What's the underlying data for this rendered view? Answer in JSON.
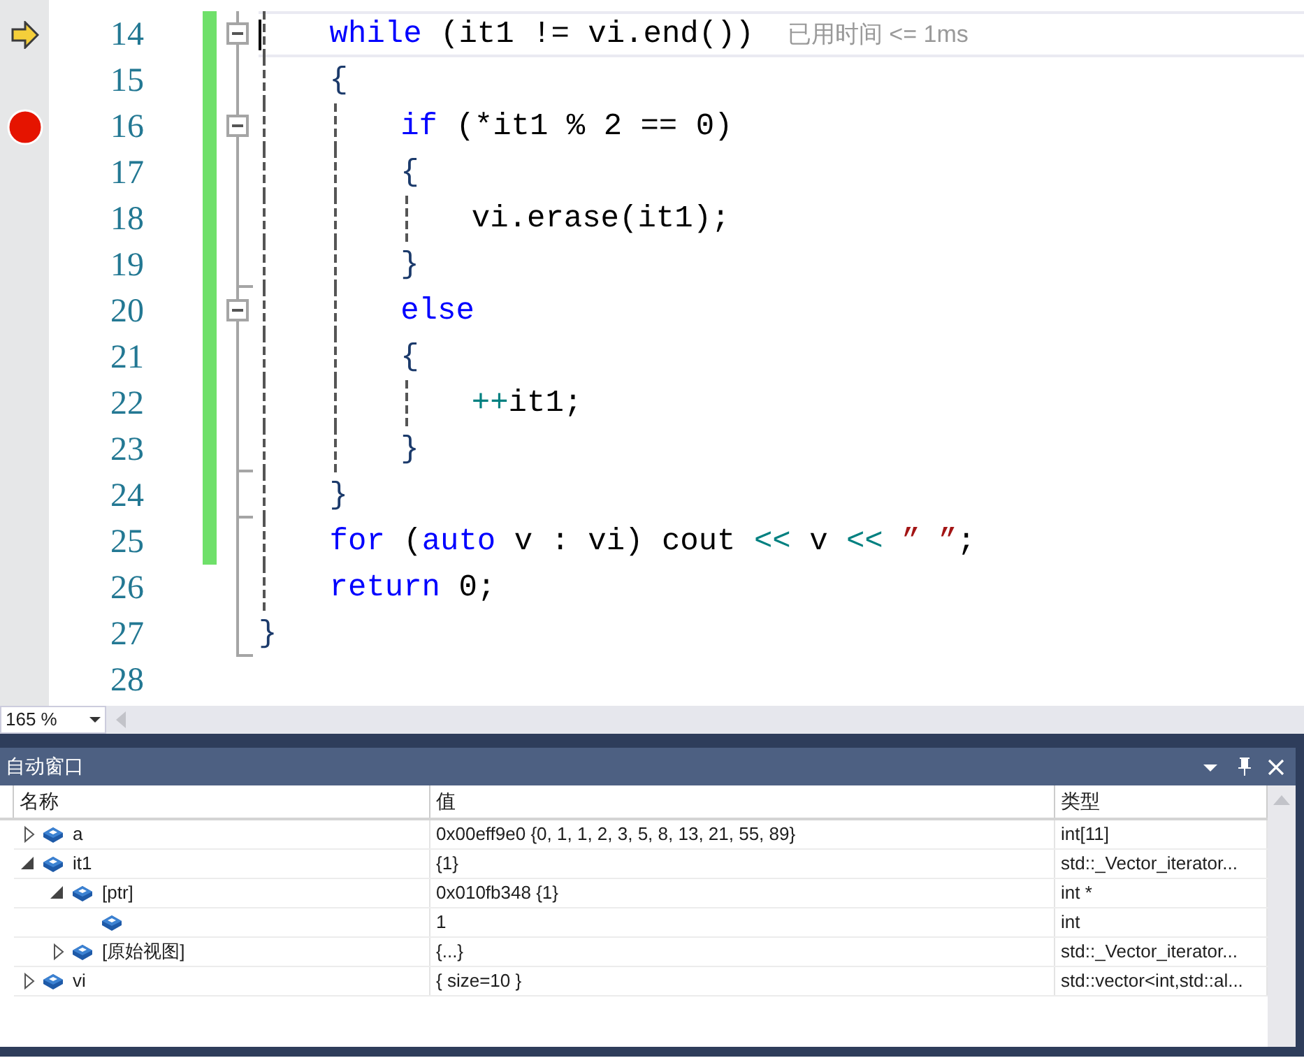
{
  "editor": {
    "lines": [
      {
        "number": "14",
        "current": true,
        "breakpoint": false,
        "changed": true,
        "in_fold": true,
        "fold_start": true,
        "fold_end": false,
        "tokens": [
          {
            "kind": "keyword",
            "text": "    while"
          },
          {
            "kind": "plain",
            "text": " (it1 != vi.end())"
          }
        ],
        "hint": "已用时间 <= 1ms"
      },
      {
        "number": "15",
        "current": false,
        "breakpoint": false,
        "changed": true,
        "in_fold": true,
        "fold_start": false,
        "fold_end": false,
        "tokens": [
          {
            "kind": "brace",
            "text": "    {"
          }
        ]
      },
      {
        "number": "16",
        "current": false,
        "breakpoint": true,
        "changed": true,
        "in_fold": true,
        "fold_start": true,
        "fold_end": false,
        "tokens": [
          {
            "kind": "keyword",
            "text": "        if"
          },
          {
            "kind": "plain",
            "text": " (*it1 % 2 == 0)"
          }
        ]
      },
      {
        "number": "17",
        "current": false,
        "breakpoint": false,
        "changed": true,
        "in_fold": true,
        "fold_start": false,
        "fold_end": false,
        "tokens": [
          {
            "kind": "brace",
            "text": "        {"
          }
        ]
      },
      {
        "number": "18",
        "current": false,
        "breakpoint": false,
        "changed": true,
        "in_fold": true,
        "fold_start": false,
        "fold_end": false,
        "tokens": [
          {
            "kind": "plain",
            "text": "            vi.erase(it1);"
          }
        ]
      },
      {
        "number": "19",
        "current": false,
        "breakpoint": false,
        "changed": true,
        "in_fold": true,
        "fold_start": false,
        "fold_end": true,
        "tokens": [
          {
            "kind": "brace",
            "text": "        }"
          }
        ]
      },
      {
        "number": "20",
        "current": false,
        "breakpoint": false,
        "changed": true,
        "in_fold": true,
        "fold_start": true,
        "fold_end": false,
        "tokens": [
          {
            "kind": "keyword",
            "text": "        else"
          }
        ]
      },
      {
        "number": "21",
        "current": false,
        "breakpoint": false,
        "changed": true,
        "in_fold": true,
        "fold_start": false,
        "fold_end": false,
        "tokens": [
          {
            "kind": "brace",
            "text": "        {"
          }
        ]
      },
      {
        "number": "22",
        "current": false,
        "breakpoint": false,
        "changed": true,
        "in_fold": true,
        "fold_start": false,
        "fold_end": false,
        "tokens": [
          {
            "kind": "operator",
            "text": "            ++"
          },
          {
            "kind": "plain",
            "text": "it1;"
          }
        ]
      },
      {
        "number": "23",
        "current": false,
        "breakpoint": false,
        "changed": true,
        "in_fold": true,
        "fold_start": false,
        "fold_end": true,
        "tokens": [
          {
            "kind": "brace",
            "text": "        }"
          }
        ]
      },
      {
        "number": "24",
        "current": false,
        "breakpoint": false,
        "changed": true,
        "in_fold": true,
        "fold_start": false,
        "fold_end": true,
        "tokens": [
          {
            "kind": "brace",
            "text": "    }"
          }
        ]
      },
      {
        "number": "25",
        "current": false,
        "breakpoint": false,
        "changed": true,
        "in_fold": true,
        "fold_start": false,
        "fold_end": false,
        "tokens": [
          {
            "kind": "keyword",
            "text": "    for"
          },
          {
            "kind": "plain",
            "text": " ("
          },
          {
            "kind": "keyword",
            "text": "auto"
          },
          {
            "kind": "plain",
            "text": " v : vi) cout "
          },
          {
            "kind": "operator",
            "text": "<<"
          },
          {
            "kind": "plain",
            "text": " v "
          },
          {
            "kind": "operator",
            "text": "<<"
          },
          {
            "kind": "string",
            "text": " ” ”"
          },
          {
            "kind": "plain",
            "text": ";"
          }
        ]
      },
      {
        "number": "26",
        "current": false,
        "breakpoint": false,
        "changed": false,
        "in_fold": true,
        "fold_start": false,
        "fold_end": false,
        "tokens": [
          {
            "kind": "keyword",
            "text": "    return"
          },
          {
            "kind": "plain",
            "text": " 0;"
          }
        ]
      },
      {
        "number": "27",
        "current": false,
        "breakpoint": false,
        "changed": false,
        "in_fold": true,
        "fold_start": false,
        "fold_end": true,
        "tokens": [
          {
            "kind": "brace",
            "text": "}"
          }
        ]
      },
      {
        "number": "28",
        "current": false,
        "breakpoint": false,
        "changed": false,
        "in_fold": false,
        "fold_start": false,
        "fold_end": false
      }
    ],
    "zoom": "165 %"
  },
  "watch": {
    "title": "自动窗口",
    "columns": [
      "名称",
      "值",
      "类型"
    ],
    "rows": [
      {
        "name": "a",
        "value": "0x00eff9e0 {0, 1, 1, 2, 3, 5, 8, 13, 21, 55, 89}",
        "type": "int[11]",
        "expanded": false
      },
      {
        "name": "it1",
        "value": "{1}",
        "type": "std::_Vector_iterator...",
        "expanded": true,
        "children": [
          {
            "name": "[ptr]",
            "value": "0x010fb348 {1}",
            "type": "int *",
            "expanded": true,
            "children": [
              {
                "value": "1",
                "type": "int"
              }
            ]
          },
          {
            "name": "[原始视图]",
            "value": "{...}",
            "type": "std::_Vector_iterator...",
            "expanded": false
          }
        ]
      },
      {
        "name": "vi",
        "value": "{ size=10 }",
        "type": "std::vector<int,std::al...",
        "expanded": false
      }
    ]
  }
}
